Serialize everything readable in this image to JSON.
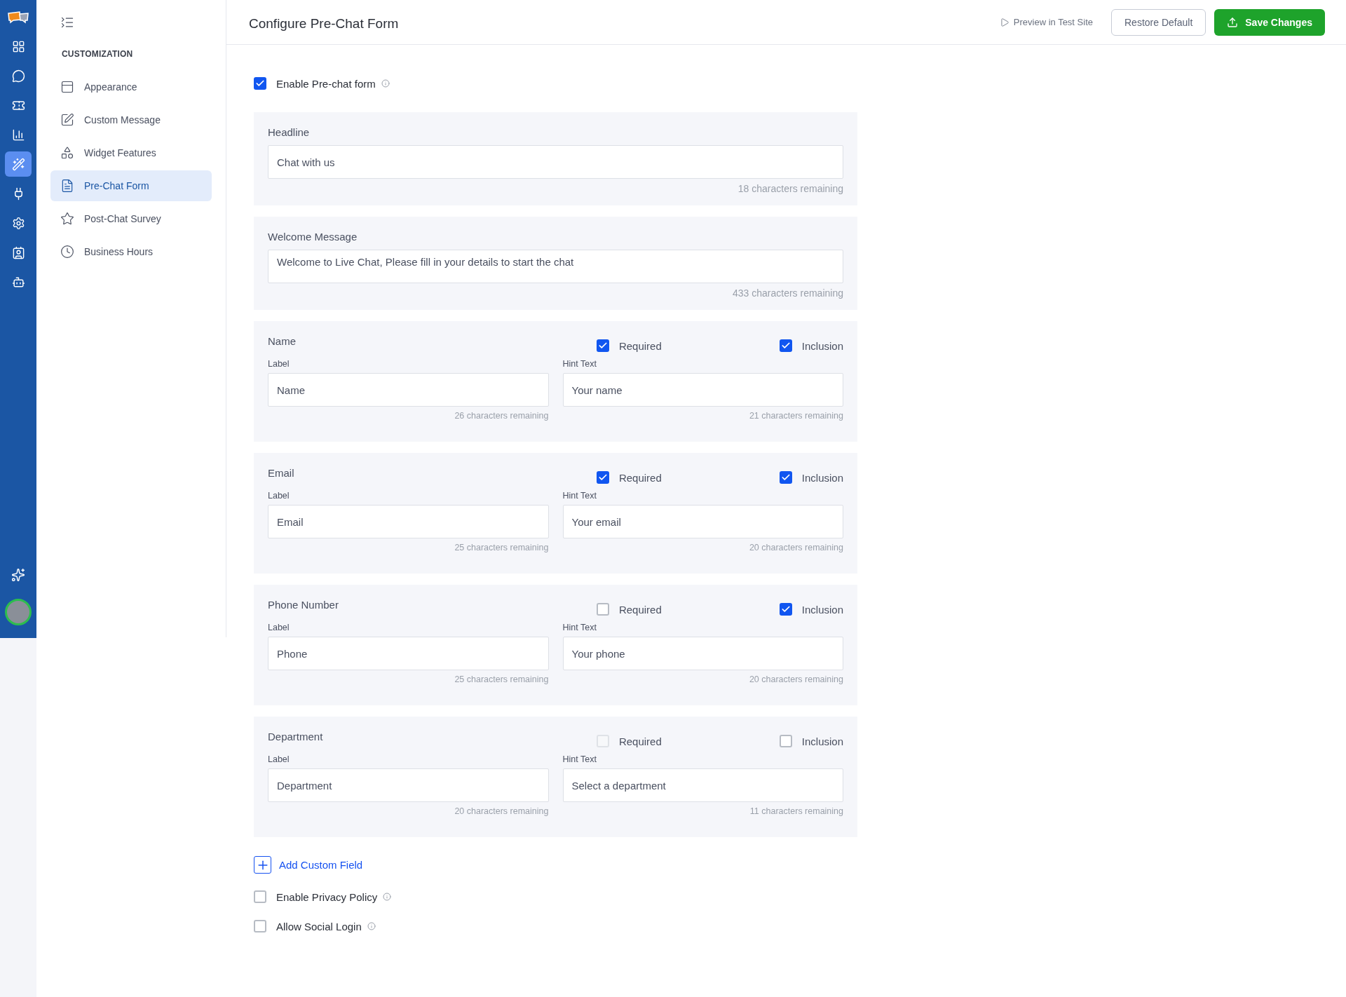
{
  "rail": {
    "items": [
      {
        "kind": "grid",
        "selected": false
      },
      {
        "kind": "chat",
        "selected": false
      },
      {
        "kind": "ticket",
        "selected": false
      },
      {
        "kind": "chart",
        "selected": false
      },
      {
        "kind": "wand",
        "selected": true
      },
      {
        "kind": "plug",
        "selected": false
      },
      {
        "kind": "settings",
        "selected": false
      },
      {
        "kind": "contacts",
        "selected": false
      },
      {
        "kind": "bot",
        "selected": false
      }
    ]
  },
  "sidebar": {
    "section": "CUSTOMIZATION",
    "items": [
      {
        "label": "Appearance",
        "kind": "layout",
        "selected": false
      },
      {
        "label": "Custom Message",
        "kind": "edit",
        "selected": false
      },
      {
        "label": "Widget Features",
        "kind": "features",
        "selected": false
      },
      {
        "label": "Pre-Chat Form",
        "kind": "file",
        "selected": true
      },
      {
        "label": "Post-Chat Survey",
        "kind": "star",
        "selected": false
      },
      {
        "label": "Business Hours",
        "kind": "clock",
        "selected": false
      }
    ]
  },
  "header": {
    "title": "Configure Pre-Chat Form",
    "preview": "Preview in Test Site",
    "restore": "Restore Default",
    "save": "Save Changes"
  },
  "enable_prechat": {
    "label": "Enable Pre-chat form",
    "checked": true
  },
  "text_sections": [
    {
      "title": "Headline",
      "value": "Chat with us",
      "remaining": "18 characters remaining"
    },
    {
      "title": "Welcome Message",
      "value": "Welcome to Live Chat, Please fill in your details to start the chat",
      "remaining": "433 characters remaining"
    }
  ],
  "fields": [
    {
      "title": "Name",
      "required": {
        "label": "Required",
        "checked": true,
        "disabled": false
      },
      "inclusion": {
        "label": "Inclusion",
        "checked": true
      },
      "label_caption": "Label",
      "label_value": "Name",
      "label_remaining": "26 characters remaining",
      "hint_caption": "Hint Text",
      "hint_value": "Your name",
      "hint_remaining": "21 characters remaining"
    },
    {
      "title": "Email",
      "required": {
        "label": "Required",
        "checked": true,
        "disabled": false
      },
      "inclusion": {
        "label": "Inclusion",
        "checked": true
      },
      "label_caption": "Label",
      "label_value": "Email",
      "label_remaining": "25 characters remaining",
      "hint_caption": "Hint Text",
      "hint_value": "Your email",
      "hint_remaining": "20 characters remaining"
    },
    {
      "title": "Phone Number",
      "required": {
        "label": "Required",
        "checked": false,
        "disabled": false
      },
      "inclusion": {
        "label": "Inclusion",
        "checked": true
      },
      "label_caption": "Label",
      "label_value": "Phone",
      "label_remaining": "25 characters remaining",
      "hint_caption": "Hint Text",
      "hint_value": "Your phone",
      "hint_remaining": "20 characters remaining"
    },
    {
      "title": "Department",
      "required": {
        "label": "Required",
        "checked": false,
        "disabled": true
      },
      "inclusion": {
        "label": "Inclusion",
        "checked": false
      },
      "label_caption": "Label",
      "label_value": "Department",
      "label_remaining": "20 characters remaining",
      "hint_caption": "Hint Text",
      "hint_value": "Select a department",
      "hint_remaining": "11 characters remaining"
    }
  ],
  "add_custom_field": "Add Custom Field",
  "options": [
    {
      "label": "Enable Privacy Policy",
      "checked": false
    },
    {
      "label": "Allow Social Login",
      "checked": false
    }
  ]
}
